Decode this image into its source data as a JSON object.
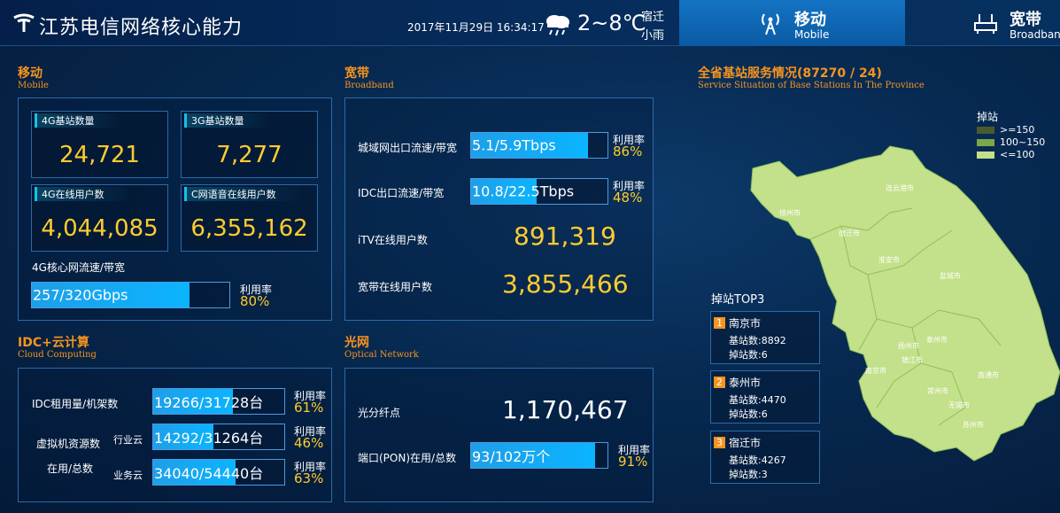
{
  "header": {
    "title": "江苏电信网络核心能力",
    "datetime": "2017年11月29日 16:34:17",
    "temperature": "2~8℃",
    "city": "宿迁",
    "weather": "小雨",
    "tabs": [
      {
        "label": "移动",
        "sub": "Mobile",
        "icon": "antenna-icon",
        "active": true
      },
      {
        "label": "宽带",
        "sub": "Broadband",
        "icon": "router-icon",
        "active": false
      }
    ]
  },
  "mobile": {
    "title": "移动",
    "sub": "Mobile",
    "stats": [
      {
        "label": "4G基站数量",
        "value": "24,721"
      },
      {
        "label": "3G基站数量",
        "value": "7,277"
      },
      {
        "label": "4G在线用户数",
        "value": "4,044,085"
      },
      {
        "label": "C网语音在线用户数",
        "value": "6,355,162"
      }
    ],
    "core_label": "4G核心网流速/带宽",
    "core_bar": {
      "text": "257/320Gbps",
      "fill": 0.8
    },
    "rate_label": "利用率",
    "core_rate": "80%"
  },
  "broadband": {
    "title": "宽带",
    "sub": "Broadband",
    "rows": [
      {
        "label": "城域网出口流速/带宽",
        "bar": "5.1/5.9Tbps",
        "fill": 0.86,
        "rate": "86%"
      },
      {
        "label": "IDC出口流速/带宽",
        "bar": "10.8/22.5Tbps",
        "fill": 0.48,
        "rate": "48%"
      }
    ],
    "rate_label": "利用率",
    "itv_label": "iTV在线用户数",
    "itv_value": "891,319",
    "online_label": "宽带在线用户数",
    "online_value": "3,855,466"
  },
  "idc": {
    "title": "IDC+云计算",
    "sub": "Cloud Computing",
    "rent_label": "IDC租用量/机架数",
    "rent_bar": "19266/31728台",
    "rent_fill": 0.61,
    "rent_rate": "61%",
    "vm_label1": "虚拟机资源数",
    "vm_label2": "在用/总数",
    "industry_label": "行业云",
    "industry_bar": "14292/31264台",
    "industry_fill": 0.46,
    "industry_rate": "46%",
    "business_label": "业务云",
    "business_bar": "34040/54440台",
    "business_fill": 0.63,
    "business_rate": "63%",
    "rate_label": "利用率"
  },
  "optical": {
    "title": "光网",
    "sub": "Optical Network",
    "fiber_label": "光分纤点",
    "fiber_value": "1,170,467",
    "pon_label": "端口(PON)在用/总数",
    "pon_bar": "93/102万个",
    "pon_fill": 0.91,
    "pon_rate": "91%",
    "rate_label": "利用率"
  },
  "map": {
    "title": "全省基站服务情况(87270 / 24)",
    "sub": "Service Situation of Base Stations In The Province",
    "legend_title": "掉站",
    "legend": [
      {
        "label": ">=150",
        "color": "#4b5a2e"
      },
      {
        "label": "100~150",
        "color": "#7aa84a"
      },
      {
        "label": "<=100",
        "color": "#c3e08a"
      }
    ],
    "cities": [
      "连云港市",
      "徐州市",
      "宿迁市",
      "淮安市",
      "盐城市",
      "扬州市",
      "泰州市",
      "镇江市",
      "南京市",
      "南通市",
      "常州市",
      "无锡市",
      "苏州市"
    ],
    "top3_title": "掉站TOP3",
    "top3": [
      {
        "rank": "1",
        "city": "南京市",
        "stations": "基站数:8892",
        "dropped": "掉站数:6"
      },
      {
        "rank": "2",
        "city": "泰州市",
        "stations": "基站数:4470",
        "dropped": "掉站数:6"
      },
      {
        "rank": "3",
        "city": "宿迁市",
        "stations": "基站数:4267",
        "dropped": "掉站数:3"
      }
    ]
  }
}
